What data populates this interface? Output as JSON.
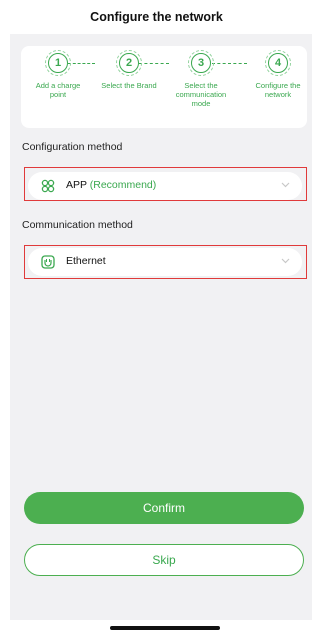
{
  "header": {
    "title": "Configure the network"
  },
  "steps": [
    {
      "number": "1",
      "label": "Add a charge point"
    },
    {
      "number": "2",
      "label": "Select the Brand"
    },
    {
      "number": "3",
      "label": "Select the communication mode"
    },
    {
      "number": "4",
      "label": "Configure the network"
    }
  ],
  "configuration": {
    "label": "Configuration method",
    "value": "APP",
    "value_note": "(Recommend)",
    "icon": "app-icon"
  },
  "communication": {
    "label": "Communication method",
    "value": "Ethernet",
    "icon": "ethernet-icon"
  },
  "buttons": {
    "confirm": "Confirm",
    "skip": "Skip"
  },
  "colors": {
    "accent": "#4caf50",
    "highlight": "#e03a3a",
    "background": "#f1f1f3"
  }
}
